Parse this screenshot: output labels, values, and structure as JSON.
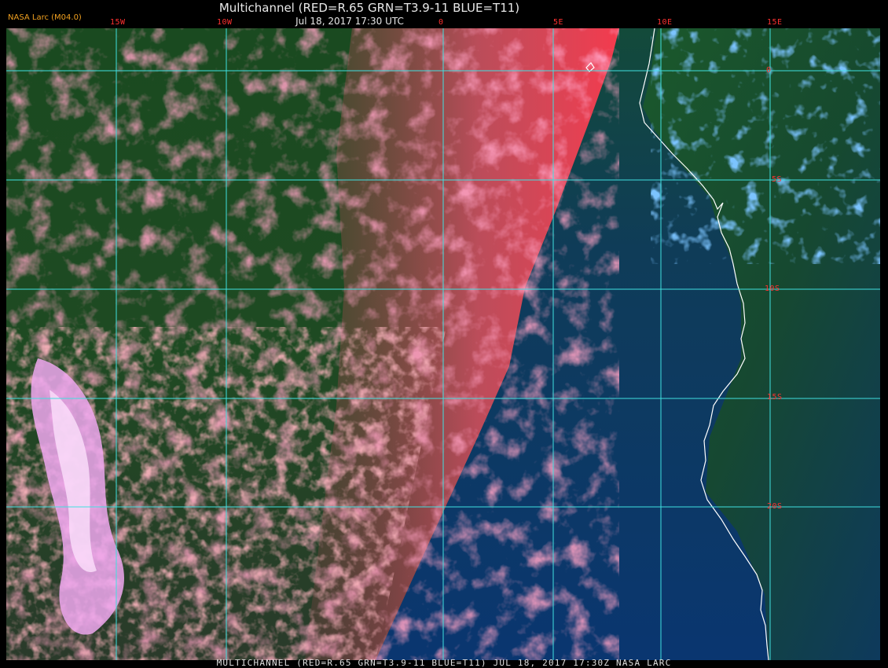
{
  "header": {
    "title": "Multichannel (RED=R.65 GRN=T3.9-11 BLUE=T11)",
    "time": "Jul 18, 2017 17:30 UTC",
    "version": "NASA Larc (M04.0)"
  },
  "map": {
    "lon_labels": [
      "15W",
      "10W",
      "0",
      "5E",
      "10E",
      "15E"
    ],
    "lat_labels": [
      "0",
      "5S",
      "10S",
      "15S",
      "20S"
    ],
    "colors": {
      "grid": "#40e0e0",
      "label": "#ff3030",
      "cloud_pink": "#ff5a8a",
      "ocean_blue": "#0c3a70",
      "land_green": "#1a4a1e",
      "coastline": "#ffffff"
    }
  },
  "footer": {
    "text": "MULTICHANNEL (RED=R.65 GRN=T3.9-11 BLUE=T11) JUL 18, 2017 17:30Z  NASA LARC"
  }
}
